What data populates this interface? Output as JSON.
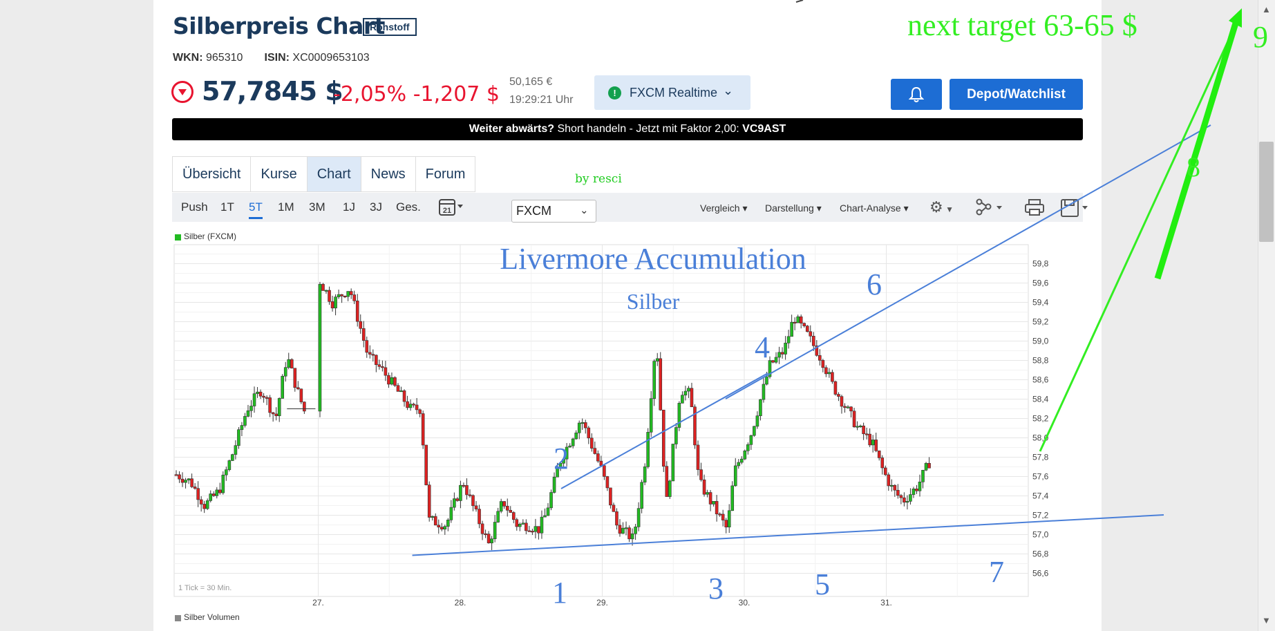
{
  "page": {
    "title": "Silberpreis Chart",
    "badge": "Rohstoff",
    "wkn_label": "WKN:",
    "wkn": "965310",
    "isin_label": "ISIN:",
    "isin": "XC0009653103",
    "price": "57,7845 $",
    "change_pct": "-2,05%",
    "change_abs": "-1,207 $",
    "eur_price": "50,165 €",
    "time": "19:29:21 Uhr",
    "source": "FXCM Realtime",
    "depot_button": "Depot/Watchlist",
    "banner_prefix": "Weiter abwärts?",
    "banner_text": " Short handeln - Jetzt mit Faktor 2,00: ",
    "banner_code": "VC9AST",
    "tabs": [
      "Übersicht",
      "Kurse",
      "Chart",
      "News",
      "Forum"
    ],
    "active_tab": "Chart",
    "periods": [
      "Push",
      "1T",
      "5T",
      "1M",
      "3M",
      "1J",
      "3J",
      "Ges."
    ],
    "active_period": "5T",
    "calendar_day": "21",
    "exchange": "FXCM",
    "dropdowns": [
      "Vergleich",
      "Darstellung",
      "Chart-Analyse"
    ],
    "legend": "Silber (FXCM)",
    "volume_legend": "Silber Volumen",
    "tick_note": "1 Tick = 30 Min."
  },
  "annotations": {
    "byline": "by resci",
    "headline": "Livermore Accumulation",
    "subline": "Silber",
    "target": "next target 63-65 $",
    "wave_labels": [
      "1",
      "2",
      "3",
      "4",
      "5",
      "6",
      "7",
      "8",
      "9"
    ]
  },
  "colors": {
    "up": "#22bb22",
    "down": "#dd2222",
    "trendline": "#4a7fd8",
    "annotation_green": "#33ee22",
    "brand": "#1b3a5c",
    "button": "#1d6dd4",
    "negative": "#e8142f"
  },
  "icons": [
    "down-circle-icon",
    "bell-icon",
    "calendar-icon",
    "gear-icon",
    "network-icon",
    "print-icon",
    "save-icon",
    "chevron-down-icon"
  ],
  "chart_data": {
    "type": "candlestick",
    "xlabel": "",
    "ylabel": "",
    "x_ticks": [
      "27.",
      "28.",
      "29.",
      "30.",
      "31."
    ],
    "y_ticks": [
      56.6,
      56.8,
      57.0,
      57.2,
      57.4,
      57.6,
      57.8,
      58.0,
      58.2,
      58.4,
      58.6,
      58.8,
      59.0,
      59.2,
      59.4,
      59.6,
      59.8
    ],
    "y_tick_labels": [
      "56,6",
      "56,8",
      "57,0",
      "57,2",
      "57,4",
      "57,6",
      "57,8",
      "58,0",
      "58,2",
      "58,4",
      "58,6",
      "58,8",
      "59,0",
      "59,2",
      "59,4",
      "59,6",
      "59,8"
    ],
    "ylim": [
      56.45,
      59.95
    ],
    "grid": true,
    "close_path": [
      [
        0,
        57.62
      ],
      [
        0.1,
        57.55
      ],
      [
        0.2,
        57.3
      ],
      [
        0.3,
        57.45
      ],
      [
        0.4,
        57.85
      ],
      [
        0.5,
        58.3
      ],
      [
        0.6,
        58.5
      ],
      [
        0.7,
        58.2
      ],
      [
        0.78,
        58.85
      ],
      [
        0.85,
        58.5
      ],
      [
        0.92,
        58.2
      ],
      [
        1.0,
        59.65
      ],
      [
        1.1,
        59.4
      ],
      [
        1.22,
        59.55
      ],
      [
        1.35,
        58.85
      ],
      [
        1.45,
        58.7
      ],
      [
        1.55,
        58.5
      ],
      [
        1.65,
        58.3
      ],
      [
        1.72,
        58.3
      ],
      [
        1.78,
        57.15
      ],
      [
        1.9,
        57.1
      ],
      [
        2.02,
        57.55
      ],
      [
        2.1,
        57.25
      ],
      [
        2.2,
        56.9
      ],
      [
        2.3,
        57.35
      ],
      [
        2.4,
        57.1
      ],
      [
        2.48,
        57.1
      ],
      [
        2.55,
        57.05
      ],
      [
        2.6,
        57.2
      ],
      [
        2.7,
        57.75
      ],
      [
        2.85,
        58.2
      ],
      [
        3.0,
        57.65
      ],
      [
        3.1,
        57.1
      ],
      [
        3.22,
        56.95
      ],
      [
        3.3,
        57.75
      ],
      [
        3.38,
        59.05
      ],
      [
        3.45,
        57.3
      ],
      [
        3.55,
        58.5
      ],
      [
        3.62,
        58.45
      ],
      [
        3.68,
        57.55
      ],
      [
        3.8,
        57.25
      ],
      [
        3.88,
        57.05
      ],
      [
        3.93,
        57.65
      ],
      [
        4.05,
        58.05
      ],
      [
        4.18,
        58.75
      ],
      [
        4.28,
        58.9
      ],
      [
        4.35,
        59.25
      ],
      [
        4.45,
        59.05
      ],
      [
        4.55,
        58.8
      ],
      [
        4.62,
        58.55
      ],
      [
        4.72,
        58.3
      ],
      [
        4.8,
        58.1
      ],
      [
        4.9,
        57.95
      ],
      [
        4.98,
        57.65
      ],
      [
        5.05,
        57.45
      ],
      [
        5.12,
        57.35
      ],
      [
        5.22,
        57.5
      ],
      [
        5.32,
        57.8
      ]
    ],
    "trendlines": [
      {
        "label": "lower",
        "from": [
          2.1,
          56.8
        ],
        "to": [
          3.85,
          56.95
        ]
      },
      {
        "label": "upper_short",
        "from": [
          2.2,
          57.45
        ],
        "to": [
          3.35,
          58.65
        ]
      },
      {
        "label": "upper_long",
        "from": [
          3.3,
          58.3
        ],
        "to": [
          4.92,
          59.42
        ]
      }
    ],
    "wave_points": [
      {
        "label": "1",
        "x": 2.19,
        "y": 56.82
      },
      {
        "label": "2",
        "x": 2.29,
        "y": 57.47
      },
      {
        "label": "3",
        "x": 3.16,
        "y": 56.85
      },
      {
        "label": "4",
        "x": 3.38,
        "y": 58.65
      },
      {
        "label": "5",
        "x": 3.53,
        "y": 56.95
      },
      {
        "label": "6",
        "x": 3.92,
        "y": 59.25
      },
      {
        "label": "7",
        "x": 4.69,
        "y": 57.1
      }
    ]
  }
}
